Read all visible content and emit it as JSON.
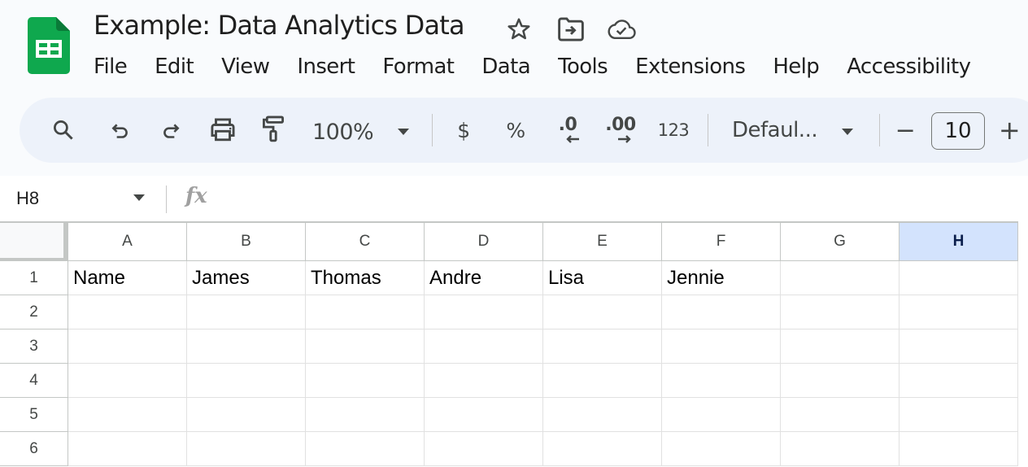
{
  "app": {
    "title": "Example: Data Analytics Data",
    "brand_color": "#0f9d58"
  },
  "title_icons": [
    {
      "name": "star-icon",
      "label": "Star"
    },
    {
      "name": "move-folder-icon",
      "label": "Move"
    },
    {
      "name": "cloud-saved-icon",
      "label": "Document status"
    }
  ],
  "menu": [
    "File",
    "Edit",
    "View",
    "Insert",
    "Format",
    "Data",
    "Tools",
    "Extensions",
    "Help",
    "Accessibility"
  ],
  "toolbar": {
    "search_icon": "search-icon",
    "undo_icon": "undo-icon",
    "redo_icon": "redo-icon",
    "print_icon": "print-icon",
    "paint_format_icon": "paint-format-icon",
    "zoom_value": "100%",
    "currency_label": "$",
    "percent_label": "%",
    "decrease_decimal_label": ".0",
    "increase_decimal_label": ".00",
    "more_formats_label": "123",
    "font_family_value": "Defaul...",
    "font_size_decrease_label": "−",
    "font_size_value": "10",
    "font_size_increase_label": "+"
  },
  "formula_bar": {
    "name_box_value": "H8",
    "fx_label": "fx",
    "formula_value": ""
  },
  "sheet": {
    "columns": [
      "A",
      "B",
      "C",
      "D",
      "E",
      "F",
      "G",
      "H"
    ],
    "selected_column": "H",
    "rows": [
      "1",
      "2",
      "3",
      "4",
      "5",
      "6"
    ],
    "cells": [
      [
        "Name",
        "James",
        "Thomas",
        "Andre",
        "Lisa",
        "Jennie",
        "",
        ""
      ],
      [
        "",
        "",
        "",
        "",
        "",
        "",
        "",
        ""
      ],
      [
        "",
        "",
        "",
        "",
        "",
        "",
        "",
        ""
      ],
      [
        "",
        "",
        "",
        "",
        "",
        "",
        "",
        ""
      ],
      [
        "",
        "",
        "",
        "",
        "",
        "",
        "",
        ""
      ],
      [
        "",
        "",
        "",
        "",
        "",
        "",
        "",
        ""
      ]
    ]
  }
}
